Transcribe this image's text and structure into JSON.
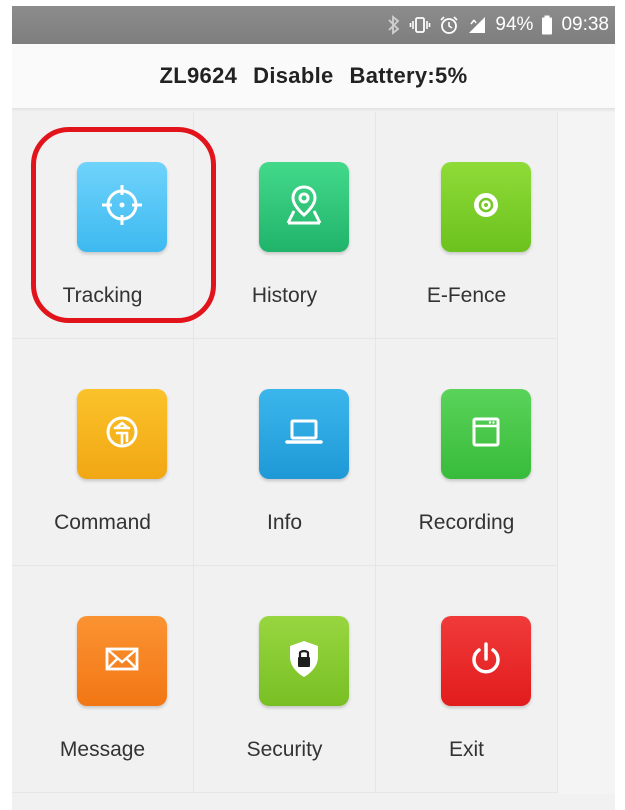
{
  "status_bar": {
    "battery_percent": "94%",
    "time": "09:38",
    "icons": [
      "bluetooth-icon",
      "vibrate-icon",
      "alarm-icon",
      "signal-icon",
      "battery-icon"
    ]
  },
  "header": {
    "device_id": "ZL9624",
    "state": "Disable",
    "battery": "Battery:5%"
  },
  "menu": {
    "items": [
      {
        "label": "Tracking",
        "icon": "crosshair-icon",
        "color": "#4fc3f7"
      },
      {
        "label": "History",
        "icon": "map-pin-icon",
        "color": "#2fc47a"
      },
      {
        "label": "E-Fence",
        "icon": "target-disc-icon",
        "color": "#7ccf2a"
      },
      {
        "label": "Command",
        "icon": "command-coin-icon",
        "color": "#f5b51c"
      },
      {
        "label": "Info",
        "icon": "laptop-icon",
        "color": "#29a9e1"
      },
      {
        "label": "Recording",
        "icon": "recorder-icon",
        "color": "#4bc94b"
      },
      {
        "label": "Message",
        "icon": "envelope-icon",
        "color": "#f7871f"
      },
      {
        "label": "Security",
        "icon": "shield-lock-icon",
        "color": "#86c832"
      },
      {
        "label": "Exit",
        "icon": "power-icon",
        "color": "#ec2a2a"
      }
    ]
  },
  "highlight_color": "#e2141b"
}
